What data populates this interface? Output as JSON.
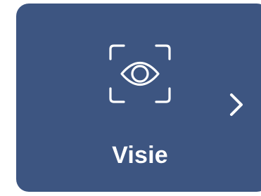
{
  "card": {
    "label": "Visie",
    "icon": "eye-scan-icon",
    "next_icon": "chevron-right-icon",
    "background_color": "#3d5581",
    "foreground_color": "#ffffff"
  }
}
